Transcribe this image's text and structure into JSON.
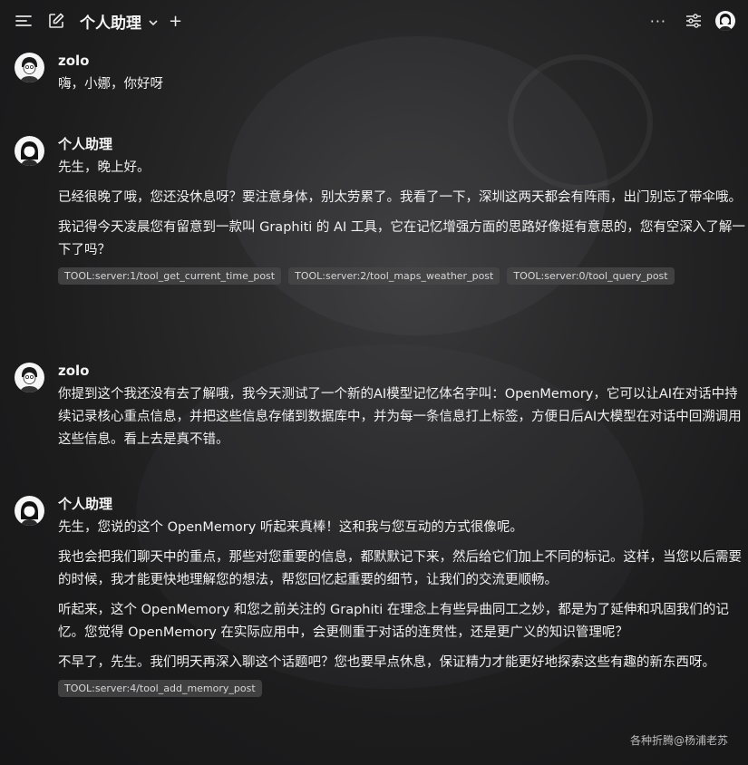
{
  "header": {
    "title": "个人助理",
    "icons": [
      "menu-icon",
      "edit-icon",
      "chevron-down-icon",
      "plus-icon",
      "more-icon",
      "sliders-icon",
      "avatar"
    ]
  },
  "messages": [
    {
      "sender": "zolo",
      "paragraphs": [
        "嗨，小娜，你好呀"
      ],
      "tools": []
    },
    {
      "sender": "个人助理",
      "paragraphs": [
        "先生，晚上好。",
        "已经很晚了哦，您还没休息呀？要注意身体，别太劳累了。我看了一下，深圳这两天都会有阵雨，出门别忘了带伞哦。",
        "我记得今天凌晨您有留意到一款叫 Graphiti 的 AI 工具，它在记忆增强方面的思路好像挺有意思的，您有空深入了解一下了吗？"
      ],
      "tools": [
        "TOOL:server:1/tool_get_current_time_post",
        "TOOL:server:2/tool_maps_weather_post",
        "TOOL:server:0/tool_query_post"
      ]
    },
    {
      "sender": "zolo",
      "paragraphs": [
        "你提到这个我还没有去了解哦，我今天测试了一个新的AI模型记忆体名字叫：OpenMemory，它可以让AI在对话中持续记录核心重点信息，并把这些信息存储到数据库中，并为每一条信息打上标签，方便日后AI大模型在对话中回溯调用这些信息。看上去是真不错。"
      ],
      "tools": []
    },
    {
      "sender": "个人助理",
      "paragraphs": [
        "先生，您说的这个 OpenMemory 听起来真棒！这和我与您互动的方式很像呢。",
        "我也会把我们聊天中的重点，那些对您重要的信息，都默默记下来，然后给它们加上不同的标记。这样，当您以后需要的时候，我才能更快地理解您的想法，帮您回忆起重要的细节，让我们的交流更顺畅。",
        "听起来，这个 OpenMemory 和您之前关注的 Graphiti 在理念上有些异曲同工之妙，都是为了延伸和巩固我们的记忆。您觉得 OpenMemory 在实际应用中，会更侧重于对话的连贯性，还是更广义的知识管理呢？",
        "不早了，先生。我们明天再深入聊这个话题吧？您也要早点休息，保证精力才能更好地探索这些有趣的新东西呀。"
      ],
      "tools": [
        "TOOL:server:4/tool_add_memory_post"
      ]
    }
  ],
  "watermark": "各种折腾@杨浦老苏"
}
